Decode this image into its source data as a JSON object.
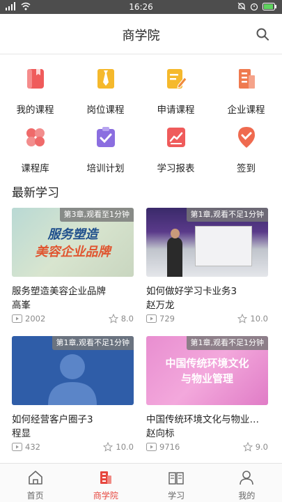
{
  "status_bar": {
    "time": "16:26",
    "signal": "4G"
  },
  "header": {
    "title": "商学院",
    "search_icon": "search-icon"
  },
  "grid": [
    {
      "label": "我的课程",
      "icon": "book-icon",
      "color": "#ef5b5b"
    },
    {
      "label": "岗位课程",
      "icon": "tie-icon",
      "color": "#f5b92c"
    },
    {
      "label": "申请课程",
      "icon": "edit-doc-icon",
      "color": "#f5b92c"
    },
    {
      "label": "企业课程",
      "icon": "building-icon",
      "color": "#ef7a4f"
    },
    {
      "label": "课程库",
      "icon": "clover-icon",
      "color": "#ef6a6a"
    },
    {
      "label": "培训计划",
      "icon": "clipboard-check-icon",
      "color": "#8b6ee0"
    },
    {
      "label": "学习报表",
      "icon": "chart-icon",
      "color": "#ef5b5b"
    },
    {
      "label": "签到",
      "icon": "location-check-icon",
      "color": "#ef6a4f"
    }
  ],
  "section_title": "最新学习",
  "courses": [
    {
      "badge": "第3章,观看至1分钟",
      "title": "服务塑造美容企业品牌",
      "author": "高峯",
      "views": "2002",
      "rating": "8.0",
      "thumb_line1": "服务塑造",
      "thumb_line2": "美容企业品牌"
    },
    {
      "badge": "第1章,观看不足1分钟",
      "title": "如何做好学习卡业务3",
      "author": "赵万龙",
      "views": "729",
      "rating": "10.0",
      "thumb_line1": "",
      "thumb_line2": ""
    },
    {
      "badge": "第1章,观看不足1分钟",
      "title": "如何经营客户圈子3",
      "author": "程显",
      "views": "432",
      "rating": "10.0",
      "thumb_line1": "",
      "thumb_line2": ""
    },
    {
      "badge": "第1章,观看不足1分钟",
      "title": "中国传统环境文化与物业管理",
      "author": "赵向标",
      "views": "9716",
      "rating": "9.0",
      "thumb_line1": "中国传统环境文化",
      "thumb_line2": "与物业管理"
    }
  ],
  "tabs": [
    {
      "label": "首页",
      "icon": "home-icon",
      "active": false
    },
    {
      "label": "商学院",
      "icon": "academy-icon",
      "active": true
    },
    {
      "label": "学习",
      "icon": "open-book-icon",
      "active": false
    },
    {
      "label": "我的",
      "icon": "user-icon",
      "active": false
    }
  ],
  "colors": {
    "accent": "#e6473f",
    "text": "#222222",
    "muted": "#8a8a8a"
  }
}
